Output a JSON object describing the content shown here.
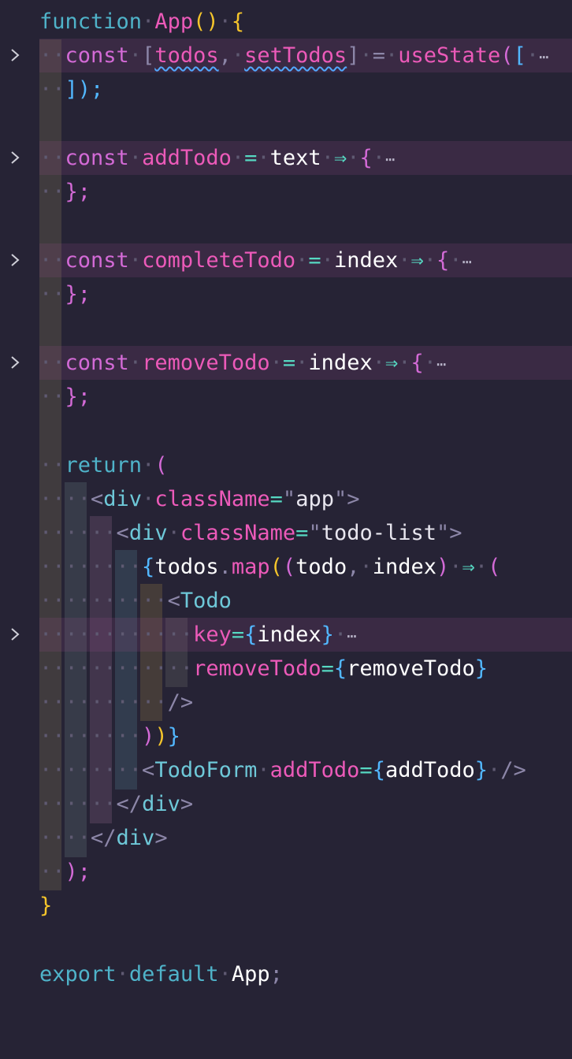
{
  "editor": {
    "lines": [
      {
        "text": "function App() {"
      },
      {
        "text": "const [todos, setTodos] = useState([",
        "folded": true
      },
      {
        "text": "]);"
      },
      {
        "text": ""
      },
      {
        "text": "const addTodo = text => {",
        "folded": true
      },
      {
        "text": "};"
      },
      {
        "text": ""
      },
      {
        "text": "const completeTodo = index => {",
        "folded": true
      },
      {
        "text": "};"
      },
      {
        "text": ""
      },
      {
        "text": "const removeTodo = index => {",
        "folded": true
      },
      {
        "text": "};"
      },
      {
        "text": ""
      },
      {
        "text": "return ("
      },
      {
        "text": "<div className=\"app\">"
      },
      {
        "text": "<div className=\"todo-list\">"
      },
      {
        "text": "{todos.map((todo, index) => ("
      },
      {
        "text": "<Todo"
      },
      {
        "text": "key={index}",
        "folded": true
      },
      {
        "text": "removeTodo={removeTodo}"
      },
      {
        "text": "/>"
      },
      {
        "text": "))}"
      },
      {
        "text": "<TodoForm addTodo={addTodo} />"
      },
      {
        "text": "</div>"
      },
      {
        "text": "</div>"
      },
      {
        "text": ");"
      },
      {
        "text": "}"
      },
      {
        "text": ""
      },
      {
        "text": "export default App;"
      }
    ],
    "tokens": {
      "function": "function",
      "App": "App",
      "parens": "()",
      "brace_open": "{",
      "const": "const",
      "bracket_open": "[",
      "todos": "todos",
      "comma": ",",
      "setTodos": "setTodos",
      "bracket_close": "]",
      "eq": "=",
      "useState": "useState",
      "paren_open": "(",
      "close_state": "]);",
      "addTodo": "addTodo",
      "text_param": "text",
      "arrow": "⇒",
      "brace_semi": "};",
      "completeTodo": "completeTodo",
      "index": "index",
      "removeTodo": "removeTodo",
      "return": "return",
      "lt": "<",
      "gt": ">",
      "div": "div",
      "className": "className",
      "quote": "\"",
      "app": "app",
      "todo_list": "todo-list",
      "todos_map_open": "{",
      "dot": ".",
      "map": "map",
      "todo": "todo",
      "paren_close": ")",
      "Todo": "Todo",
      "key": "key",
      "brace_close": "}",
      "slash_gt": "/>",
      "close_map_parens": "))",
      "close_map_brace": "}",
      "TodoForm": "TodoForm",
      "lt_slash": "</",
      "paren_semi": ");",
      "final_brace": "}",
      "export": "export",
      "default": "default",
      "semi": ";",
      "ellipsis": "⋯"
    },
    "colors": {
      "background": "#262335",
      "keyword_blue": "#4fb3c9",
      "keyword_purple": "#d36ad6",
      "function_pink": "#ec5ab9",
      "bracket_yellow": "#f5c52b",
      "bracket_blue": "#52b7ff",
      "operator_green": "#56d8c2",
      "fold_highlight": "#3a2a44"
    },
    "icons": {
      "fold": "chevron-right-icon",
      "folded_marker": "ellipsis-icon"
    }
  }
}
